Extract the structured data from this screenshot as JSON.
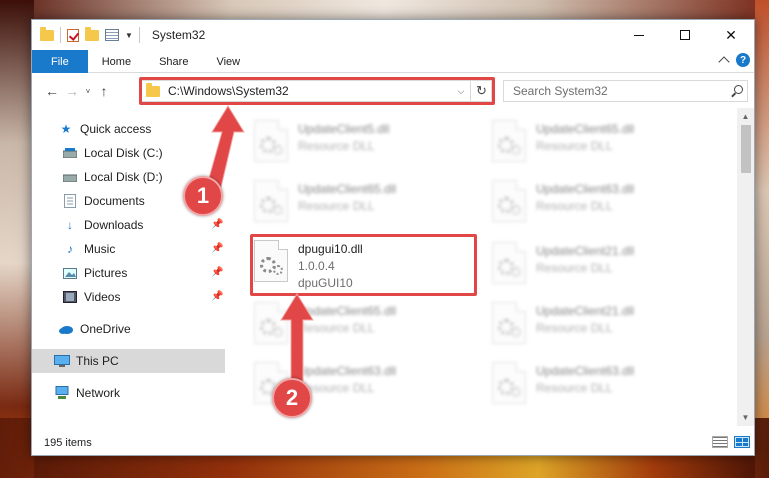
{
  "window": {
    "title": "System32",
    "controls": {
      "minimize": "",
      "maximize": "",
      "close": "✕"
    }
  },
  "ribbon": {
    "tabs": [
      "File",
      "Home",
      "Share",
      "View"
    ]
  },
  "navigation": {
    "address": "C:\\Windows\\System32",
    "search_placeholder": "Search System32"
  },
  "sidebar": {
    "items": [
      {
        "label": "Quick access",
        "icon": "star-icon",
        "pinned": false
      },
      {
        "label": "Local Disk (C:)",
        "icon": "drive-icon",
        "pinned": false
      },
      {
        "label": "Local Disk (D:)",
        "icon": "drive-icon",
        "pinned": false
      },
      {
        "label": "Documents",
        "icon": "documents-icon",
        "pinned": true
      },
      {
        "label": "Downloads",
        "icon": "downloads-icon",
        "pinned": true
      },
      {
        "label": "Music",
        "icon": "music-icon",
        "pinned": true
      },
      {
        "label": "Pictures",
        "icon": "pictures-icon",
        "pinned": true
      },
      {
        "label": "Videos",
        "icon": "videos-icon",
        "pinned": true
      },
      {
        "label": "OneDrive",
        "icon": "cloud-icon",
        "pinned": false
      },
      {
        "label": "This PC",
        "icon": "computer-icon",
        "pinned": false,
        "selected": true
      },
      {
        "label": "Network",
        "icon": "network-icon",
        "pinned": false
      }
    ]
  },
  "files": [
    {
      "name": "UpdateClient5.dll",
      "desc": "Resource DLL",
      "blurred": true
    },
    {
      "name": "UpdateClient65.dll",
      "desc": "Resource DLL",
      "blurred": true
    },
    {
      "name": "UpdateClient65.dll",
      "desc": "Resource DLL",
      "blurred": true
    },
    {
      "name": "UpdateClient63.dll",
      "desc": "Resource DLL",
      "blurred": true
    },
    {
      "name": "dpugui10.dll",
      "version": "1.0.0.4",
      "desc": "dpuGUI10",
      "blurred": false
    },
    {
      "name": "UpdateClient21.dll",
      "desc": "Resource DLL",
      "blurred": true
    },
    {
      "name": "UpdateClient65.dll",
      "desc": "Resource DLL",
      "blurred": true
    },
    {
      "name": "UpdateClient21.dll",
      "desc": "Resource DLL",
      "blurred": true
    },
    {
      "name": "UpdateClient63.dll",
      "desc": "Resource DLL",
      "blurred": true
    },
    {
      "name": "UpdateClient63.dll",
      "desc": "Resource DLL",
      "blurred": true
    }
  ],
  "status": {
    "item_count": "195 items"
  },
  "annotations": {
    "step1": "1",
    "step2": "2"
  },
  "colors": {
    "accent": "#1979ca",
    "highlight": "#e14747"
  }
}
